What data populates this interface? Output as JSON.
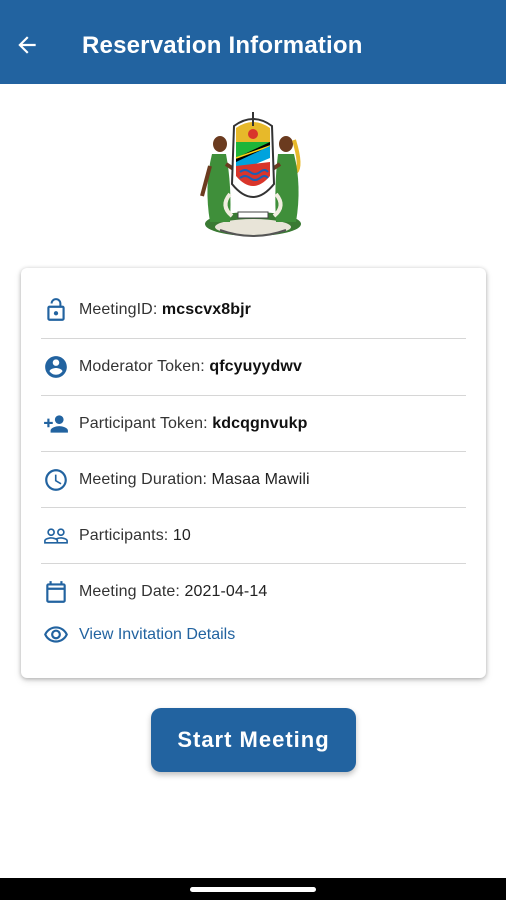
{
  "app_bar": {
    "title": "Reservation Information",
    "back_icon": "arrow-back-icon",
    "color": "#2263a0"
  },
  "emblem": {
    "icon": "coat-of-arms-of-tanzania"
  },
  "details": [
    {
      "icon": "lock-icon",
      "label": "MeetingID: ",
      "value": "mcscvx8bjr"
    },
    {
      "icon": "account-circle-icon",
      "label": "Moderator Token: ",
      "value": "qfcyuyydwv"
    },
    {
      "icon": "person-add-icon",
      "label": "Participant Token: ",
      "value": "kdcqgnvukp"
    },
    {
      "icon": "clock-icon",
      "label": "Meeting Duration: ",
      "value": "Masaa Mawili"
    },
    {
      "icon": "people-icon",
      "label": "Participants: ",
      "value": "10"
    },
    {
      "icon": "calendar-icon",
      "label": "Meeting Date: ",
      "value": "2021-04-14"
    }
  ],
  "invitation_link": {
    "icon": "eye-icon",
    "label": "View Invitation Details"
  },
  "start_button": {
    "label": "Start Meeting"
  }
}
